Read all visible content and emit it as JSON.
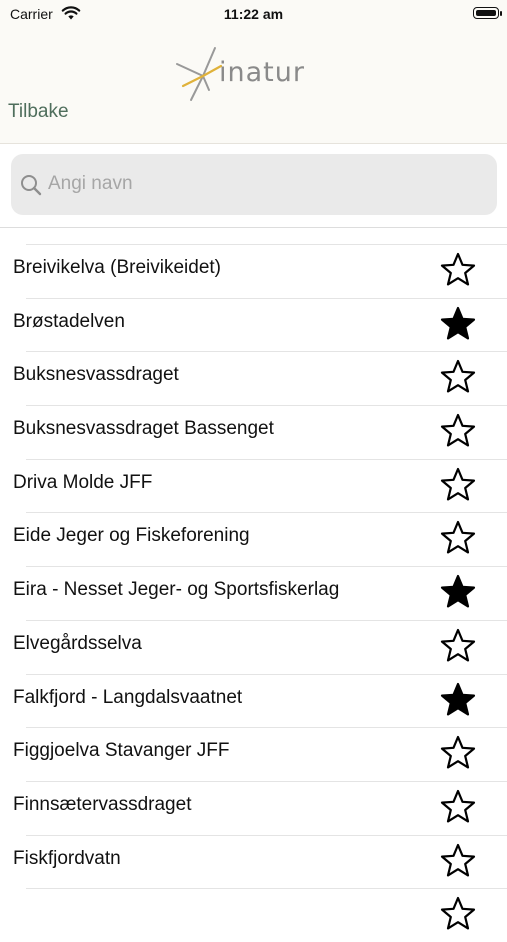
{
  "status_bar": {
    "carrier": "Carrier",
    "time": "11:22 am"
  },
  "header": {
    "back_label": "Tilbake",
    "logo_text": "inatur"
  },
  "search": {
    "placeholder": "Angi navn",
    "value": ""
  },
  "colors": {
    "back": "#4f6e5c",
    "logo_text": "#8a8a8a",
    "logo_accent": "#e0b23a"
  },
  "list": [
    {
      "name": "Breivikelva (Breivikeidet)",
      "favorite": false
    },
    {
      "name": "Brøstadelven",
      "favorite": true
    },
    {
      "name": "Buksnesvassdraget",
      "favorite": false
    },
    {
      "name": "Buksnesvassdraget Bassenget",
      "favorite": false
    },
    {
      "name": "Driva Molde JFF",
      "favorite": false
    },
    {
      "name": "Eide Jeger og Fiskeforening",
      "favorite": false
    },
    {
      "name": "Eira - Nesset Jeger- og Sportsfiskerlag",
      "favorite": true
    },
    {
      "name": "Elvegårdsselva",
      "favorite": false
    },
    {
      "name": "Falkfjord - Langdalsvaatnet",
      "favorite": true
    },
    {
      "name": "Figgjoelva Stavanger JFF",
      "favorite": false
    },
    {
      "name": "Finnsætervassdraget",
      "favorite": false
    },
    {
      "name": "Fiskfjordvatn",
      "favorite": false
    },
    {
      "name": "",
      "favorite": false
    }
  ]
}
